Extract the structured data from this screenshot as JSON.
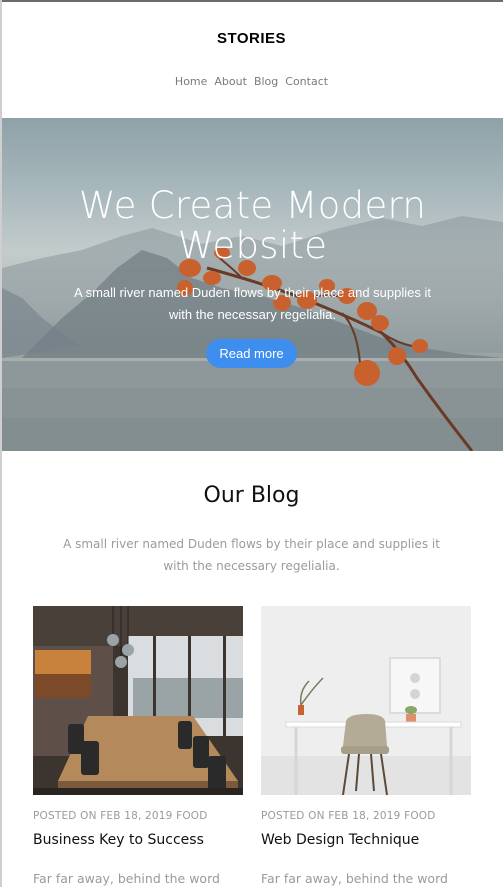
{
  "header": {
    "brand": "STORIES",
    "nav": [
      "Home",
      "About",
      "Blog",
      "Contact"
    ]
  },
  "hero": {
    "title_line1": "We Create Modern",
    "title_line2": "Website",
    "subtitle_line1": "A small river named Duden flows by their place and supplies it",
    "subtitle_line2": "with the necessary regelialia.",
    "button": "Read more"
  },
  "blog": {
    "title": "Our Blog",
    "subtitle_line1": "A small river named Duden flows by their place and supplies it",
    "subtitle_line2": "with the necessary regelialia.",
    "posts": [
      {
        "meta": "POSTED ON FEB 18, 2019 FOOD",
        "title": "Business Key to Success",
        "excerpt": "Far far away, behind the word"
      },
      {
        "meta": "POSTED ON FEB 18, 2019 FOOD",
        "title": "Web Design Technique",
        "excerpt": "Far far away, behind the word"
      }
    ]
  },
  "colors": {
    "accent": "#3e8ef0",
    "muted_text": "#9a9a9a",
    "nav_text": "#7a7a7a"
  }
}
